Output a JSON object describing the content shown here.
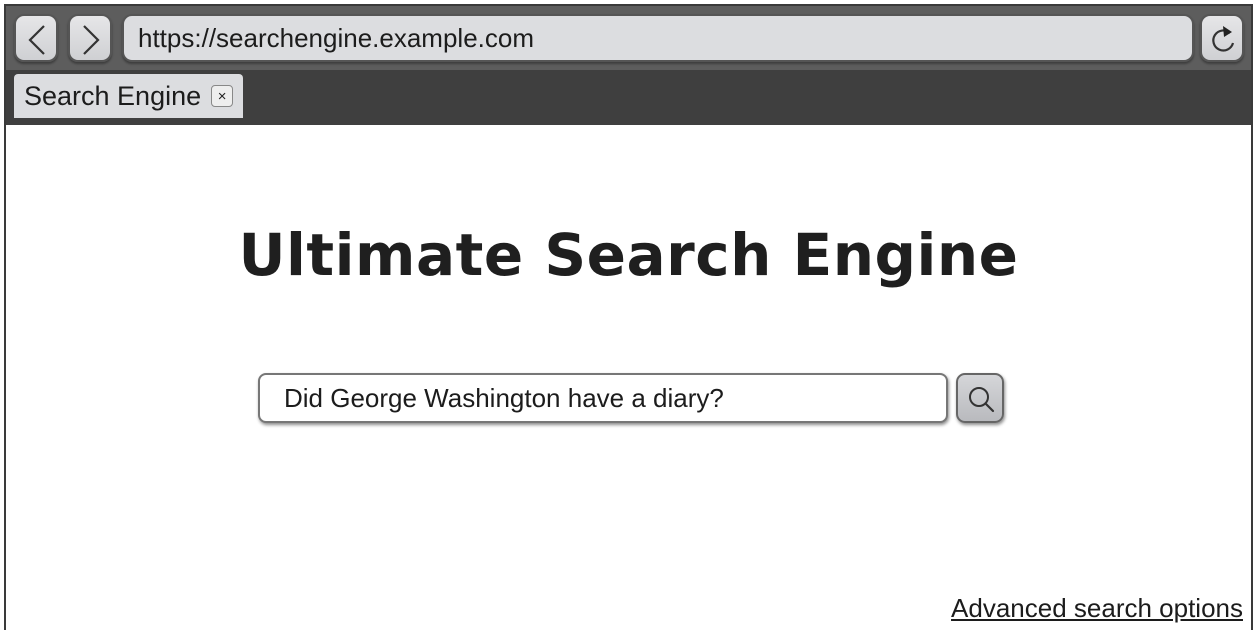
{
  "browser": {
    "back_icon": "chevron-left-icon",
    "forward_icon": "chevron-right-icon",
    "url": "https://searchengine.example.com",
    "reload_icon": "reload-icon"
  },
  "tabs": [
    {
      "label": "Search Engine",
      "close_icon": "close-icon",
      "close_glyph": "×"
    }
  ],
  "main": {
    "title": "Ultimate Search Engine",
    "search_query": "Did George Washington have a diary?",
    "search_icon": "magnifier-icon",
    "advanced_link": "Advanced search options"
  },
  "colors": {
    "toolbar": "#5d5d5d",
    "tabstrip": "#3f3f3f",
    "url_bar": "#dcdde0"
  }
}
